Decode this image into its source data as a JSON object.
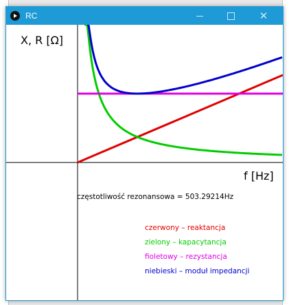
{
  "window": {
    "title": "RC",
    "buttons": {
      "minimize": "minimize-icon",
      "maximize": "maximize-icon",
      "close": "close-icon"
    }
  },
  "axes": {
    "y_label": "X, R [Ω]",
    "x_label": "f [Hz]"
  },
  "info": {
    "resonance_text": "częstotliwość rezonansowa = 503.29214Hz"
  },
  "legend": [
    {
      "text": "czerwony – reaktancja",
      "color": "#e00000"
    },
    {
      "text": "zielony – kapacytancja",
      "color": "#00cc00"
    },
    {
      "text": "fioletowy – rezystancja",
      "color": "#e000e0"
    },
    {
      "text": "niebieski – moduł impedancji",
      "color": "#0000cc"
    }
  ],
  "chart_data": {
    "type": "line",
    "xlabel": "f [Hz]",
    "ylabel": "X, R [Ω]",
    "series": [
      {
        "name": "czerwony – reaktancja",
        "color": "#e00000",
        "shape": "linear"
      },
      {
        "name": "zielony – kapacytancja",
        "color": "#00cc00",
        "shape": "inverse"
      },
      {
        "name": "fioletowy – rezystancja",
        "color": "#e000e0",
        "shape": "constant"
      },
      {
        "name": "niebieski – moduł impedancji",
        "color": "#0000cc",
        "shape": "impedance"
      }
    ]
  }
}
